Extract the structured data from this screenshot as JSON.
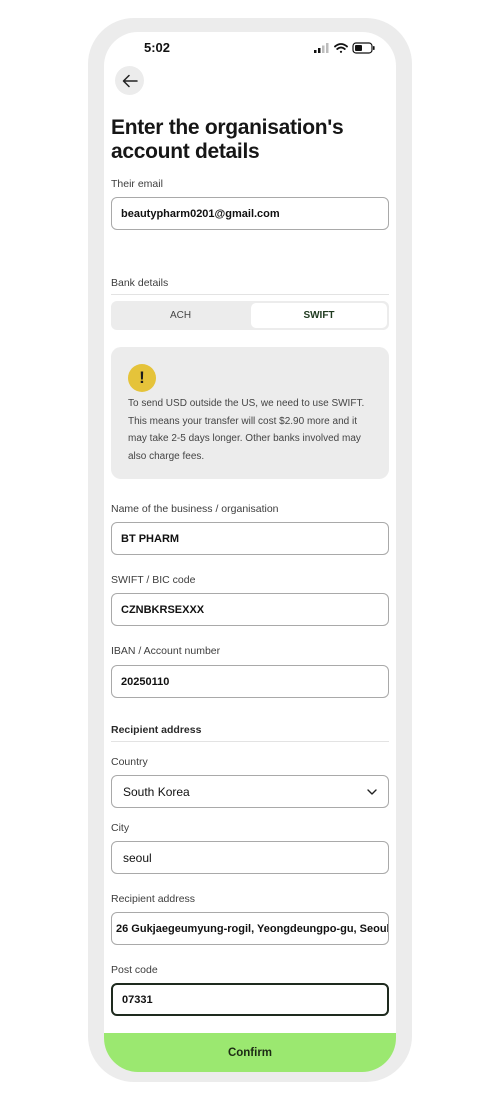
{
  "status_bar": {
    "time": "5:02"
  },
  "page": {
    "title": "Enter the organisation's account details"
  },
  "email": {
    "label": "Their email",
    "value": "beautypharm0201@gmail.com"
  },
  "bank": {
    "section_label": "Bank details",
    "tabs": [
      {
        "label": "ACH"
      },
      {
        "label": "SWIFT"
      }
    ],
    "selected_tab": "SWIFT"
  },
  "notice": {
    "icon": "exclamation-icon",
    "text": "To send USD outside the US, we need to use SWIFT. This means your transfer will cost $2.90 more and it may take 2-5 days longer. Other banks involved may also charge fees."
  },
  "business_name": {
    "label": "Name of the business / organisation",
    "value": "BT PHARM"
  },
  "swift": {
    "label": "SWIFT / BIC code",
    "value": "CZNBKRSEXXX"
  },
  "iban": {
    "label": "IBAN / Account number",
    "value": "20250110"
  },
  "recipient": {
    "section_label": "Recipient address",
    "country": {
      "label": "Country",
      "value": "South Korea"
    },
    "city": {
      "label": "City",
      "value": "seoul"
    },
    "address": {
      "label": "Recipient address",
      "value": "26 Gukjaegeumyung-rogil, Yeongdeungpo-gu, Seoul"
    },
    "postcode": {
      "label": "Post code",
      "value": "07331"
    }
  },
  "confirm": {
    "label": "Confirm"
  },
  "colors": {
    "accent": "#9be870",
    "warning": "#e5c33a",
    "surface": "#ececec"
  }
}
